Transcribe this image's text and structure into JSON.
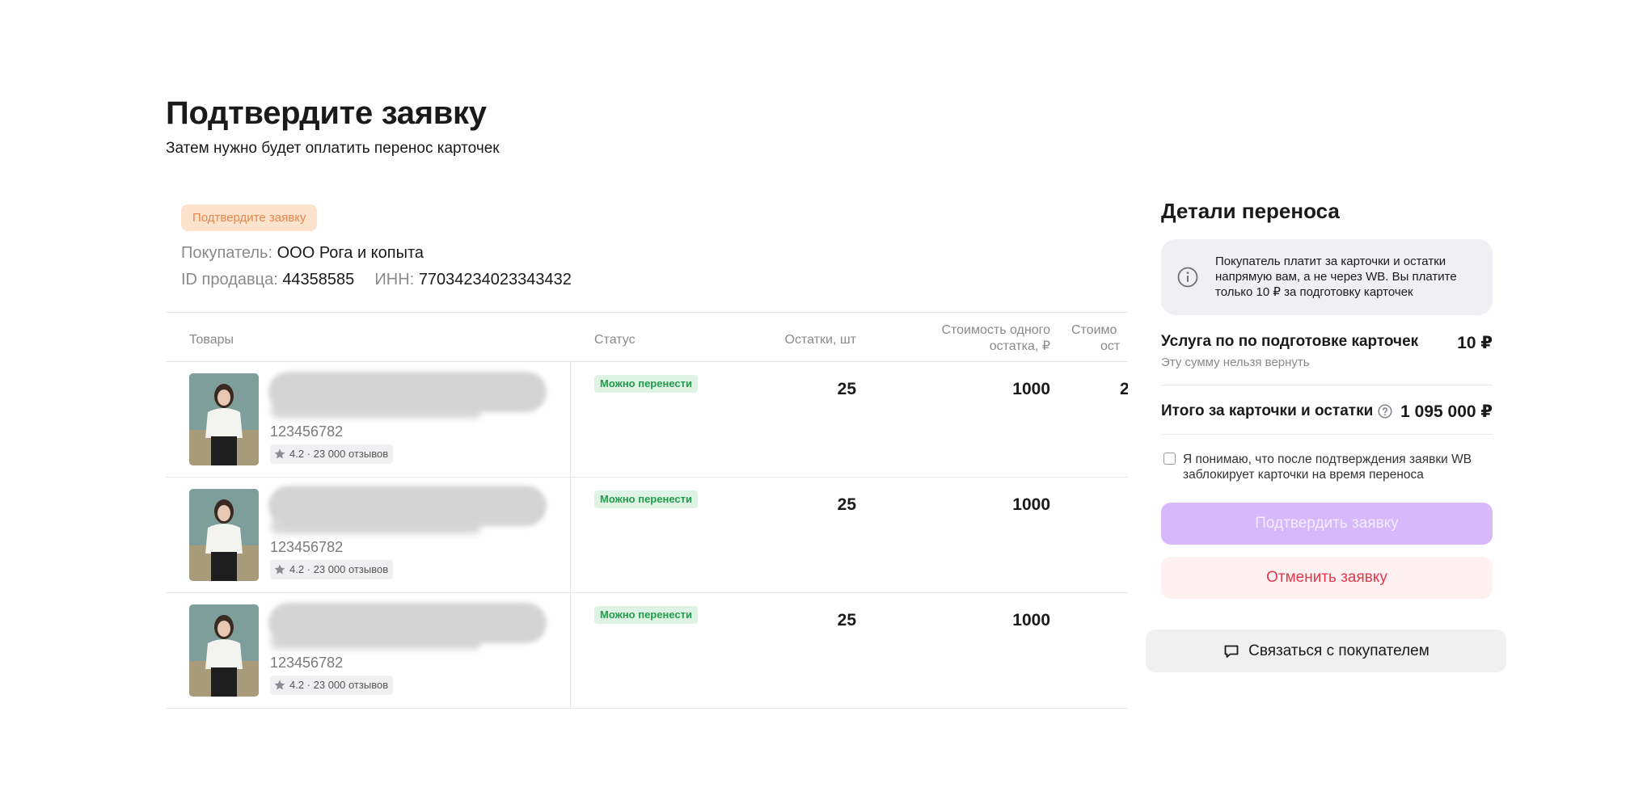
{
  "header": {
    "title": "Подтвердите заявку",
    "subtitle": "Затем нужно будет оплатить перенос карточек"
  },
  "request": {
    "status_badge": "Подтвердите заявку",
    "buyer_label": "Покупатель:",
    "buyer_value": "ООО Рога и копыта",
    "seller_id_label": "ID продавца:",
    "seller_id_value": "44358585",
    "inn_label": "ИНН:",
    "inn_value": "77034234023343432"
  },
  "table": {
    "columns": [
      "Товары",
      "Статус",
      "Остатки, шт",
      "Стоимость одного остатка, ₽",
      "Стоимо... ост..."
    ],
    "col_goods": "Товары",
    "col_status": "Статус",
    "col_stock": "Остатки, шт",
    "col_unit_line1": "Стоимость одного",
    "col_unit_line2": "остатка, ₽",
    "col_total_line1": "Стоимо",
    "col_total_line2": "ост",
    "rows": [
      {
        "sku": "123456782",
        "rating": "4.2 · 23 000 отзывов",
        "status": "Можно перенести",
        "stock": "25",
        "unit_price": "1000",
        "total_partial": "2"
      },
      {
        "sku": "123456782",
        "rating": "4.2 · 23 000 отзывов",
        "status": "Можно перенести",
        "stock": "25",
        "unit_price": "1000",
        "total_partial": ""
      },
      {
        "sku": "123456782",
        "rating": "4.2 · 23 000 отзывов",
        "status": "Можно перенести",
        "stock": "25",
        "unit_price": "1000",
        "total_partial": ""
      }
    ]
  },
  "details": {
    "title": "Детали переноса",
    "info_icon": "info-circle-icon",
    "info_text": "Покупатель платит за карточки и остатки напрямую вам, а не через WB. Вы платите только 10 ₽ за подготовку карточек",
    "service_label": "Услуга по по подготовке карточек",
    "service_note": "Эту сумму нельзя вернуть",
    "service_price": "10 ₽",
    "total_label": "Итого за карточки и остатки",
    "total_price": "1 095 000 ₽",
    "agree_text": "Я понимаю, что после подтверждения заявки WB заблокирует карточки на время переноса",
    "agree_checked": false,
    "confirm_button": "Подтвердить заявку",
    "cancel_button": "Отменить заявку",
    "contact_button": "Связаться с покупателем"
  },
  "colors": {
    "accent_disabled": "#d7b8fb",
    "danger": "#e03a4b",
    "success": "#1f9d4c",
    "warning": "#e8864b"
  }
}
